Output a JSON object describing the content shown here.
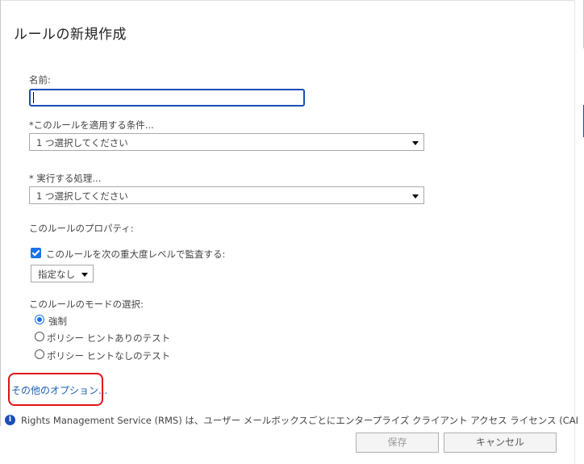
{
  "dialog": {
    "title": "ルールの新規作成"
  },
  "name_field": {
    "label": "名前:",
    "value": ""
  },
  "condition": {
    "label": "*このルールを適用する条件...",
    "selected": "1 つ選択してください"
  },
  "action": {
    "label": "* 実行する処理...",
    "selected": "1 つ選択してください"
  },
  "properties": {
    "label": "このルールのプロパティ:",
    "audit_checkbox": {
      "label": "このルールを次の重大度レベルで監査する:",
      "checked": true
    },
    "severity": {
      "selected": "指定なし"
    }
  },
  "mode": {
    "label": "このルールのモードの選択:",
    "options": [
      {
        "label": "強制",
        "selected": true
      },
      {
        "label": "ポリシー ヒントありのテスト",
        "selected": false
      },
      {
        "label": "ポリシー ヒントなしのテスト",
        "selected": false
      }
    ]
  },
  "more_options_link": "その他のオプション...",
  "info": {
    "icon": "info-icon",
    "text": "Rights Management Service (RMS) は、ユーザー メールボックスごとにエンタープライズ クライアント アクセス ライセンス (CAL) また"
  },
  "buttons": {
    "save": "保存",
    "cancel": "キャンセル"
  },
  "colors": {
    "accent": "#1a73e8",
    "link": "#1a5fb4",
    "highlight": "#e0121a"
  }
}
